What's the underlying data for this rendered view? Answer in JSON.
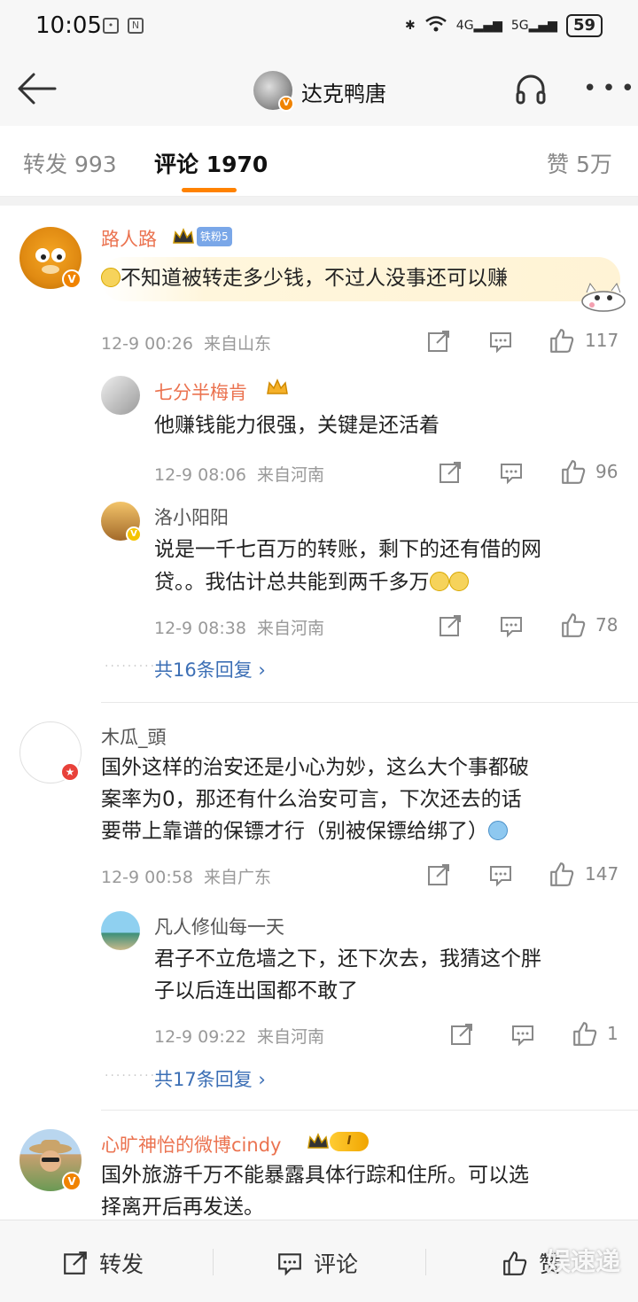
{
  "status_bar": {
    "time": "10:05",
    "network1": "4G",
    "network2": "5G",
    "battery": "59"
  },
  "nav": {
    "title": "达克鸭唐"
  },
  "tabs": {
    "repost": "转发 993",
    "comment": "评论 1970",
    "like": "赞 5万"
  },
  "comments": [
    {
      "user": "路人路",
      "fan_badge": "铁粉5",
      "text": "不知道被转走多少钱，不过人没事还可以赚",
      "time": "12-9 00:26",
      "location": "来自山东",
      "likes": "117",
      "replies": [
        {
          "user": "七分半梅肯",
          "text": "他赚钱能力很强，关键是还活着",
          "time": "12-9 08:06",
          "location": "来自河南",
          "likes": "96"
        },
        {
          "user": "洛小阳阳",
          "text_line1": "说是一千七百万的转账，剩下的还有借的网",
          "text_line2": "贷。。我估计总共能到两千多万",
          "time": "12-9 08:38",
          "location": "来自河南",
          "likes": "78"
        }
      ],
      "more_replies": "共16条回复 ›"
    },
    {
      "user": "木瓜_頭",
      "text_line1": "国外这样的治安还是小心为妙，这么大个事都破",
      "text_line2": "案率为0，那还有什么治安可言，下次还去的话",
      "text_line3": "要带上靠谱的保镖才行（别被保镖给绑了）",
      "time": "12-9 00:58",
      "location": "来自广东",
      "likes": "147",
      "replies": [
        {
          "user": "凡人修仙每一天",
          "text_line1": "君子不立危墙之下，还下次去，我猜这个胖",
          "text_line2": "子以后连出国都不敢了",
          "time": "12-9 09:22",
          "location": "来自河南",
          "likes": "1"
        }
      ],
      "more_replies": "共17条回复 ›"
    },
    {
      "user": "心旷神怡的微博cindy",
      "vip_badge": "I",
      "text_line1": "国外旅游千万不能暴露具体行踪和住所。可以选",
      "text_line2": "择离开后再发送。"
    }
  ],
  "bottom_bar": {
    "repost": "转发",
    "comment": "评论",
    "like": "赞"
  },
  "watermark": "娱速递",
  "colors": {
    "accent": "#ff8200",
    "username_orange": "#eb7350",
    "link_blue": "#3c6fb5"
  }
}
